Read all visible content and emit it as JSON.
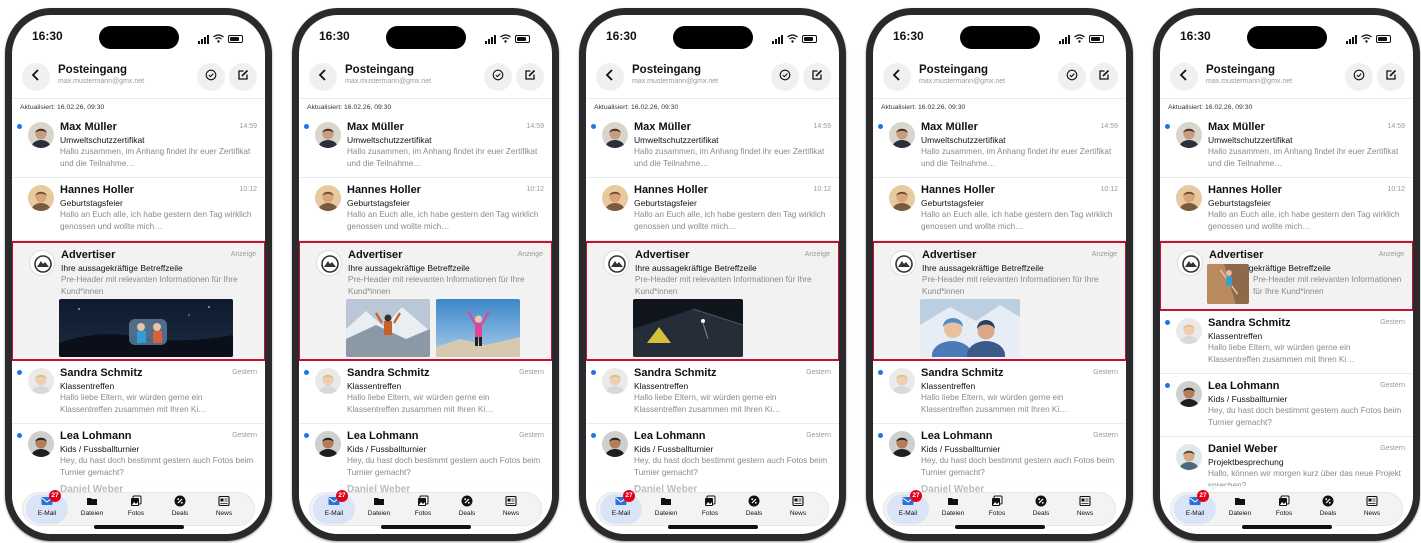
{
  "status": {
    "time": "16:30"
  },
  "header": {
    "title": "Posteingang",
    "account": "max.mustermann@gmx.net"
  },
  "updated": "Aktualisiert: 16.02.26, 09:30",
  "colors": {
    "accent": "#1e73e8",
    "highlight": "#c8102e",
    "badge": "#e2001a"
  },
  "mails": {
    "max": {
      "sender": "Max Müller",
      "time": "14:59",
      "subject": "Umweltschutzzertifikat",
      "preview": "Hallo zusammen, im Anhang findet ihr euer Zertifikat und die Teilnahme…"
    },
    "hannes": {
      "sender": "Hannes Holler",
      "time": "10:12",
      "subject": "Geburtstagsfeier",
      "preview": "Hallo an Euch alle, ich habe gestern den Tag wirklich genossen und wollte mich…"
    },
    "sandra": {
      "sender": "Sandra Schmitz",
      "time": "Gestern",
      "subject": "Klassentreffen",
      "preview": "Hallo liebe Eltern, wir würden gerne ein Klassentreffen zusammen mit Ihren Ki…"
    },
    "lea": {
      "sender": "Lea Lohmann",
      "time": "Gestern",
      "subject": "Kids / Fussballturnier",
      "preview": "Hey, du hast doch bestimmt gestern auch Fotos beim Turnier gemacht?"
    },
    "daniel": {
      "sender": "Daniel Weber",
      "time": "Gestern",
      "subject": "Projektbesprechung",
      "preview": "Hallo, können wir morgen kurz über das neue Projekt sprechen?"
    },
    "ghost": {
      "sender": "Daniel Weber"
    }
  },
  "ad": {
    "sender": "Advertiser",
    "label": "Anzeige",
    "subject": "Ihre aussagekräftige Betreffzeile",
    "preview": "Pre-Header mit relevanten Informationen für Ihre Kund*innen"
  },
  "tabs": {
    "mail": {
      "label": "E-Mail",
      "badge": "27",
      "icon": "mail-icon"
    },
    "files": {
      "label": "Dateien",
      "icon": "folder-icon"
    },
    "photos": {
      "label": "Fotos",
      "icon": "photos-icon"
    },
    "deals": {
      "label": "Deals",
      "icon": "deals-icon"
    },
    "news": {
      "label": "News",
      "icon": "news-icon"
    }
  }
}
